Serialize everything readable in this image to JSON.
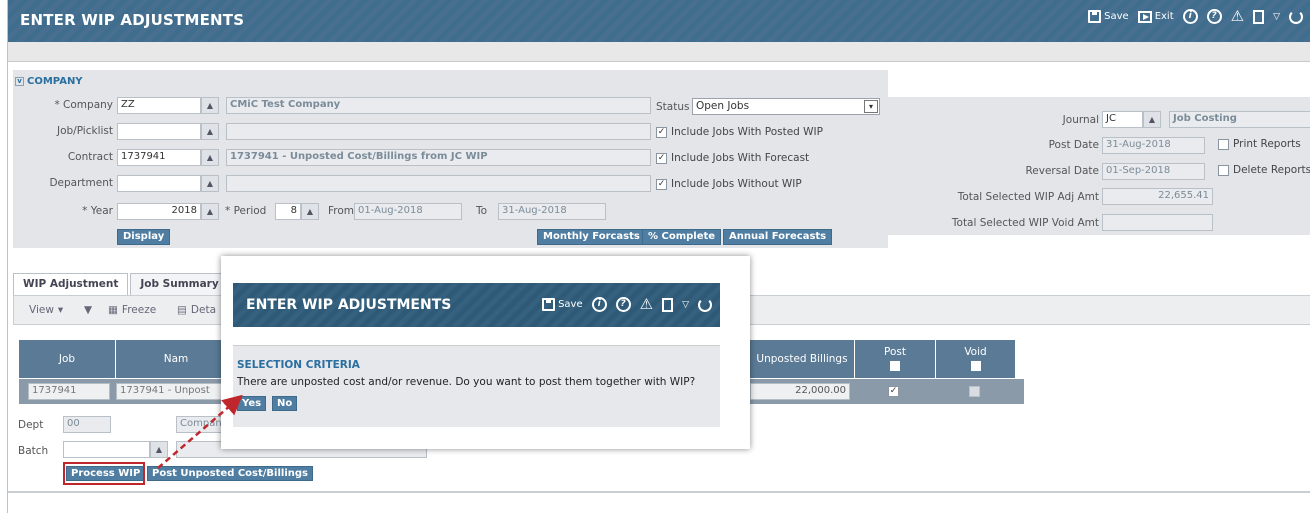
{
  "header": {
    "title": "ENTER WIP ADJUSTMENTS",
    "save": "Save",
    "exit": "Exit"
  },
  "company_section": {
    "title": "COMPANY",
    "company_label": "* Company",
    "company_value": "ZZ",
    "company_name": "CMiC Test Company",
    "job_label": "Job/Picklist",
    "job_value": "",
    "job_desc": "",
    "contract_label": "Contract",
    "contract_value": "1737941",
    "contract_desc": "1737941 - Unposted Cost/Billings from JC WIP",
    "department_label": "Department",
    "department_value": "",
    "department_desc": "",
    "year_label": "* Year",
    "year_value": "2018",
    "period_label": "* Period",
    "period_value": "8",
    "from_label": "From",
    "from_value": "01-Aug-2018",
    "to_label": "To",
    "to_value": "31-Aug-2018",
    "display_button": "Display",
    "status_label": "Status",
    "status_value": "Open Jobs",
    "include_posted": "Include Jobs With Posted WIP",
    "include_forecast": "Include Jobs With Forecast",
    "include_without": "Include Jobs Without WIP",
    "monthly_forecasts": "Monthly Forcasts",
    "pct_complete": "% Complete",
    "annual_forecasts": "Annual Forecasts"
  },
  "right_section": {
    "journal_label": "Journal",
    "journal_value": "JC",
    "journal_desc": "Job Costing",
    "post_date_label": "Post Date",
    "post_date_value": "31-Aug-2018",
    "reversal_date_label": "Reversal Date",
    "reversal_date_value": "01-Sep-2018",
    "total_adj_label": "Total Selected WIP Adj Amt",
    "total_adj_value": "22,655.41",
    "total_void_label": "Total Selected WIP Void Amt",
    "total_void_value": "",
    "print_reports": "Print Reports",
    "delete_reports": "Delete Reports"
  },
  "tabs": [
    "WIP Adjustment",
    "Job Summary"
  ],
  "grid_toolbar": {
    "view": "View",
    "freeze": "Freeze",
    "detach": "Deta"
  },
  "grid": {
    "headers": [
      "Job",
      "Nam",
      "Unposted Billings",
      "Post",
      "Void"
    ],
    "row": {
      "job": "1737941",
      "name": "1737941 - Unpost",
      "unposted_billings": "22,000.00"
    }
  },
  "bottom": {
    "dept_label": "Dept",
    "dept_value": "00",
    "company_partial": "Compan",
    "batch_label": "Batch",
    "process_wip": "Process WIP",
    "post_unposted": "Post Unposted Cost/Billings"
  },
  "modal": {
    "title": "ENTER WIP ADJUSTMENTS",
    "save": "Save",
    "section": "SELECTION CRITERIA",
    "message": "There are unposted cost and/or revenue. Do you want to post them together with WIP?",
    "yes": "Yes",
    "no": "No"
  },
  "colors": {
    "header_bg": "#426c8c",
    "button_bg": "#4f7ea2",
    "section_title": "#2a6fa0",
    "highlight_red": "#c0272d"
  }
}
